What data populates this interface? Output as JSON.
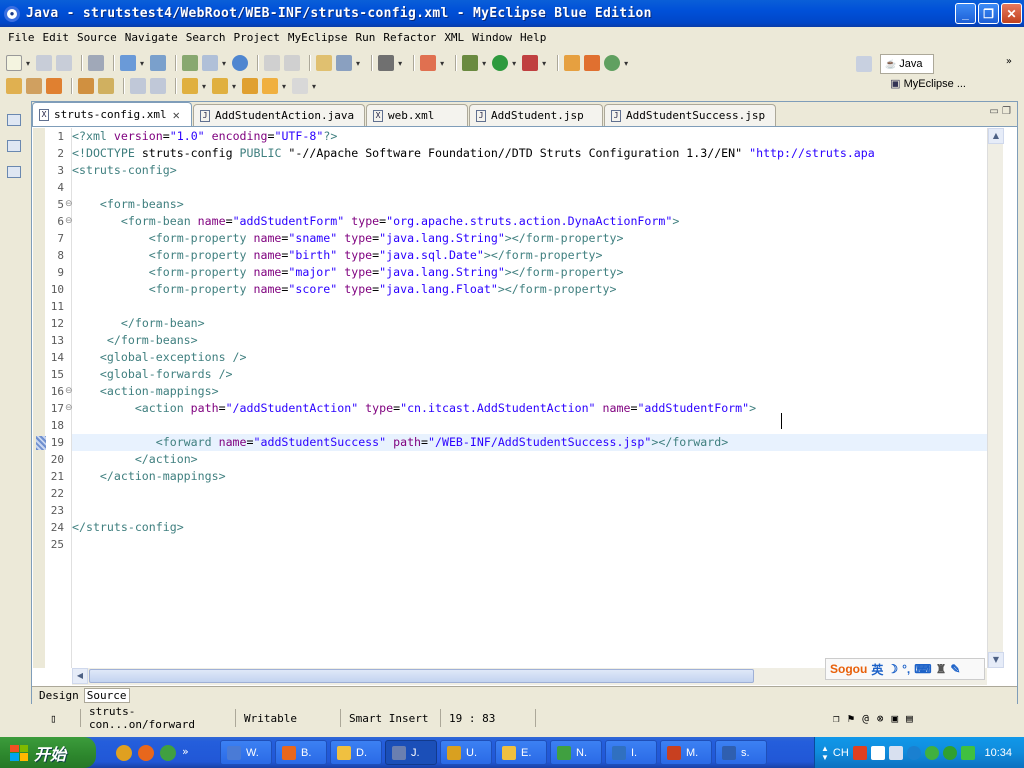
{
  "window": {
    "title": "Java - strutstest4/WebRoot/WEB-INF/struts-config.xml - MyEclipse Blue Edition"
  },
  "menu": [
    "File",
    "Edit",
    "Source",
    "Navigate",
    "Search",
    "Project",
    "MyEclipse",
    "Run",
    "Refactor",
    "XML",
    "Window",
    "Help"
  ],
  "perspective": {
    "java_label": "Java",
    "myeclipse_label": "MyEclipse ..."
  },
  "tabs": [
    {
      "label": "struts-config.xml",
      "active": true,
      "icon": "xml-file-icon"
    },
    {
      "label": "AddStudentAction.java",
      "active": false,
      "icon": "java-file-icon"
    },
    {
      "label": "web.xml",
      "active": false,
      "icon": "xml-file-icon"
    },
    {
      "label": "AddStudent.jsp",
      "active": false,
      "icon": "jsp-file-icon"
    },
    {
      "label": "AddStudentSuccess.jsp",
      "active": false,
      "icon": "jsp-file-icon"
    }
  ],
  "editor": {
    "current_line": 19,
    "lines": [
      {
        "n": "1",
        "fold": "",
        "parts": [
          [
            "tag",
            "<?xml "
          ],
          [
            "attr",
            "version"
          ],
          [
            "txt",
            "="
          ],
          [
            "val",
            "\"1.0\""
          ],
          [
            "attr",
            " encoding"
          ],
          [
            "txt",
            "="
          ],
          [
            "val",
            "\"UTF-8\""
          ],
          [
            "tag",
            "?>"
          ]
        ]
      },
      {
        "n": "2",
        "fold": "",
        "parts": [
          [
            "tag",
            "<!DOCTYPE "
          ],
          [
            "txt",
            "struts-config "
          ],
          [
            "tag",
            "PUBLIC "
          ],
          [
            "txt",
            "\"-//Apache Software Foundation//DTD Struts Configuration 1.3//EN\" "
          ],
          [
            "val",
            "\"http://struts.apa"
          ]
        ]
      },
      {
        "n": "3",
        "fold": "",
        "parts": [
          [
            "tag",
            "<struts-config>"
          ]
        ]
      },
      {
        "n": "4",
        "fold": "",
        "parts": []
      },
      {
        "n": "5",
        "fold": "⊖",
        "parts": [
          [
            "txt",
            "    "
          ],
          [
            "tag",
            "<form-beans>"
          ]
        ]
      },
      {
        "n": "6",
        "fold": "⊖",
        "parts": [
          [
            "txt",
            "       "
          ],
          [
            "tag",
            "<form-bean "
          ],
          [
            "attr",
            "name"
          ],
          [
            "txt",
            "="
          ],
          [
            "val",
            "\"addStudentForm\""
          ],
          [
            "attr",
            " type"
          ],
          [
            "txt",
            "="
          ],
          [
            "val",
            "\"org.apache.struts.action.DynaActionForm\""
          ],
          [
            "tag",
            ">"
          ]
        ]
      },
      {
        "n": "7",
        "fold": "",
        "parts": [
          [
            "txt",
            "           "
          ],
          [
            "tag",
            "<form-property "
          ],
          [
            "attr",
            "name"
          ],
          [
            "txt",
            "="
          ],
          [
            "val",
            "\"sname\""
          ],
          [
            "attr",
            " type"
          ],
          [
            "txt",
            "="
          ],
          [
            "val",
            "\"java.lang.String\""
          ],
          [
            "tag",
            "></form-property>"
          ]
        ]
      },
      {
        "n": "8",
        "fold": "",
        "parts": [
          [
            "txt",
            "           "
          ],
          [
            "tag",
            "<form-property "
          ],
          [
            "attr",
            "name"
          ],
          [
            "txt",
            "="
          ],
          [
            "val",
            "\"birth\""
          ],
          [
            "attr",
            " type"
          ],
          [
            "txt",
            "="
          ],
          [
            "val",
            "\"java.sql.Date\""
          ],
          [
            "tag",
            "></form-property>"
          ]
        ]
      },
      {
        "n": "9",
        "fold": "",
        "parts": [
          [
            "txt",
            "           "
          ],
          [
            "tag",
            "<form-property "
          ],
          [
            "attr",
            "name"
          ],
          [
            "txt",
            "="
          ],
          [
            "val",
            "\"major\""
          ],
          [
            "attr",
            " type"
          ],
          [
            "txt",
            "="
          ],
          [
            "val",
            "\"java.lang.String\""
          ],
          [
            "tag",
            "></form-property>"
          ]
        ]
      },
      {
        "n": "10",
        "fold": "",
        "parts": [
          [
            "txt",
            "           "
          ],
          [
            "tag",
            "<form-property "
          ],
          [
            "attr",
            "name"
          ],
          [
            "txt",
            "="
          ],
          [
            "val",
            "\"score\""
          ],
          [
            "attr",
            " type"
          ],
          [
            "txt",
            "="
          ],
          [
            "val",
            "\"java.lang.Float\""
          ],
          [
            "tag",
            "></form-property>"
          ]
        ]
      },
      {
        "n": "11",
        "fold": "",
        "parts": []
      },
      {
        "n": "12",
        "fold": "",
        "parts": [
          [
            "txt",
            "       "
          ],
          [
            "tag",
            "</form-bean>"
          ]
        ]
      },
      {
        "n": "13",
        "fold": "",
        "parts": [
          [
            "txt",
            "     "
          ],
          [
            "tag",
            "</form-beans>"
          ]
        ]
      },
      {
        "n": "14",
        "fold": "",
        "parts": [
          [
            "txt",
            "    "
          ],
          [
            "tag",
            "<global-exceptions />"
          ]
        ]
      },
      {
        "n": "15",
        "fold": "",
        "parts": [
          [
            "txt",
            "    "
          ],
          [
            "tag",
            "<global-forwards />"
          ]
        ]
      },
      {
        "n": "16",
        "fold": "⊖",
        "parts": [
          [
            "txt",
            "    "
          ],
          [
            "tag",
            "<action-mappings>"
          ]
        ]
      },
      {
        "n": "17",
        "fold": "⊖",
        "parts": [
          [
            "txt",
            "         "
          ],
          [
            "tag",
            "<action "
          ],
          [
            "attr",
            "path"
          ],
          [
            "txt",
            "="
          ],
          [
            "val",
            "\"/addStudentAction\""
          ],
          [
            "attr",
            " type"
          ],
          [
            "txt",
            "="
          ],
          [
            "val",
            "\"cn.itcast.AddStudentAction\""
          ],
          [
            "attr",
            " name"
          ],
          [
            "txt",
            "="
          ],
          [
            "val",
            "\"addStudentForm\""
          ],
          [
            "tag",
            ">"
          ]
        ]
      },
      {
        "n": "18",
        "fold": "",
        "parts": []
      },
      {
        "n": "19",
        "fold": "",
        "parts": [
          [
            "txt",
            "            "
          ],
          [
            "tag",
            "<forward "
          ],
          [
            "attr",
            "name"
          ],
          [
            "txt",
            "="
          ],
          [
            "val",
            "\"addStudentSuccess\""
          ],
          [
            "attr",
            " path"
          ],
          [
            "txt",
            "="
          ],
          [
            "val",
            "\"/WEB-INF/AddStudentSuccess.jsp\""
          ],
          [
            "tag",
            "></forward>"
          ]
        ]
      },
      {
        "n": "20",
        "fold": "",
        "parts": [
          [
            "txt",
            "         "
          ],
          [
            "tag",
            "</action>"
          ]
        ]
      },
      {
        "n": "21",
        "fold": "",
        "parts": [
          [
            "txt",
            "    "
          ],
          [
            "tag",
            "</action-mappings>"
          ]
        ]
      },
      {
        "n": "22",
        "fold": "",
        "parts": []
      },
      {
        "n": "23",
        "fold": "",
        "parts": []
      },
      {
        "n": "24",
        "fold": "",
        "parts": [
          [
            "tag",
            "</struts-config>"
          ]
        ]
      },
      {
        "n": "25",
        "fold": "",
        "parts": []
      }
    ]
  },
  "ime": {
    "brand": "Sogou",
    "mode": "英"
  },
  "bottom_tabs": [
    {
      "label": "Design",
      "active": false
    },
    {
      "label": "Source",
      "active": true
    }
  ],
  "status": {
    "path": "struts-con...on/forward",
    "writable": "Writable",
    "insert_mode": "Smart Insert",
    "position": "19 : 83"
  },
  "taskbar": {
    "start_label": "开始",
    "tasks": [
      {
        "label": "W.",
        "color": "#4a7bd6",
        "active": false
      },
      {
        "label": "B.",
        "color": "#e8671c",
        "active": false
      },
      {
        "label": "D.",
        "color": "#f0c040",
        "active": false
      },
      {
        "label": "J.",
        "color": "#6a7fb0",
        "active": true
      },
      {
        "label": "U.",
        "color": "#d9a020",
        "active": false
      },
      {
        "label": "E.",
        "color": "#f0c040",
        "active": false
      },
      {
        "label": "N.",
        "color": "#40a040",
        "active": false
      },
      {
        "label": "I.",
        "color": "#3070c0",
        "active": false
      },
      {
        "label": "M.",
        "color": "#c84020",
        "active": false
      },
      {
        "label": "s.",
        "color": "#2f5fb0",
        "active": false
      }
    ],
    "tray_lang": "CH",
    "clock": "10:34"
  }
}
